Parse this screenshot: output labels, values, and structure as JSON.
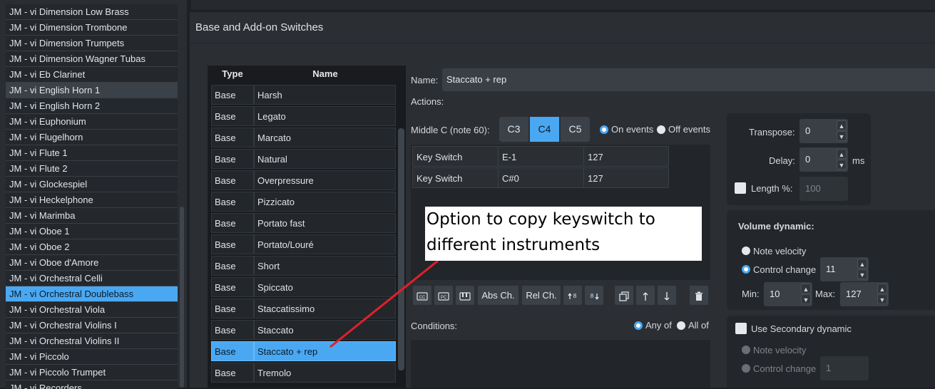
{
  "instrument_list": {
    "items": [
      {
        "label": "JM - vi Dimension Low Brass",
        "state": "normal"
      },
      {
        "label": "JM - vi Dimension Trombone",
        "state": "normal"
      },
      {
        "label": "JM - vi Dimension Trumpets",
        "state": "normal"
      },
      {
        "label": "JM - vi Dimension Wagner Tubas",
        "state": "normal"
      },
      {
        "label": "JM - vi Eb Clarinet",
        "state": "normal"
      },
      {
        "label": "JM - vi English Horn 1",
        "state": "hover"
      },
      {
        "label": "JM - vi English Horn 2",
        "state": "normal"
      },
      {
        "label": "JM - vi Euphonium",
        "state": "normal"
      },
      {
        "label": "JM - vi Flugelhorn",
        "state": "normal"
      },
      {
        "label": "JM - vi Flute 1",
        "state": "normal"
      },
      {
        "label": "JM - vi Flute 2",
        "state": "normal"
      },
      {
        "label": "JM - vi Glockespiel",
        "state": "normal"
      },
      {
        "label": "JM - vi Heckelphone",
        "state": "normal"
      },
      {
        "label": "JM - vi Marimba",
        "state": "normal"
      },
      {
        "label": "JM - vi Oboe 1",
        "state": "normal"
      },
      {
        "label": "JM - vi Oboe 2",
        "state": "normal"
      },
      {
        "label": "JM - vi Oboe d'Amore",
        "state": "normal"
      },
      {
        "label": "JM - vi Orchestral Celli",
        "state": "normal"
      },
      {
        "label": "JM - vi Orchestral Doublebass",
        "state": "selected"
      },
      {
        "label": "JM - vi Orchestral Viola",
        "state": "normal"
      },
      {
        "label": "JM - vi Orchestral Violins I",
        "state": "normal"
      },
      {
        "label": "JM - vi Orchestral Violins II",
        "state": "normal"
      },
      {
        "label": "JM - vi Piccolo",
        "state": "normal"
      },
      {
        "label": "JM - vi Piccolo Trumpet",
        "state": "normal"
      },
      {
        "label": "JM - vi Recorders",
        "state": "normal"
      }
    ]
  },
  "section": {
    "title": "Base and Add-on Switches"
  },
  "articulations": {
    "headers": {
      "type": "Type",
      "name": "Name"
    },
    "rows": [
      {
        "type": "Base",
        "name": "Harsh",
        "selected": false
      },
      {
        "type": "Base",
        "name": "Legato",
        "selected": false
      },
      {
        "type": "Base",
        "name": "Marcato",
        "selected": false
      },
      {
        "type": "Base",
        "name": "Natural",
        "selected": false
      },
      {
        "type": "Base",
        "name": "Overpressure",
        "selected": false
      },
      {
        "type": "Base",
        "name": "Pizzicato",
        "selected": false
      },
      {
        "type": "Base",
        "name": "Portato fast",
        "selected": false
      },
      {
        "type": "Base",
        "name": "Portato/Louré",
        "selected": false
      },
      {
        "type": "Base",
        "name": "Short",
        "selected": false
      },
      {
        "type": "Base",
        "name": "Spiccato",
        "selected": false
      },
      {
        "type": "Base",
        "name": "Staccatissimo",
        "selected": false
      },
      {
        "type": "Base",
        "name": "Staccato",
        "selected": false
      },
      {
        "type": "Base",
        "name": "Staccato + rep",
        "selected": true
      },
      {
        "type": "Base",
        "name": "Tremolo",
        "selected": false
      }
    ]
  },
  "editor": {
    "name_label": "Name:",
    "name_value": "Staccato + rep",
    "actions_label": "Actions:",
    "middle_c_label": "Middle C (note 60):",
    "octaves": [
      {
        "label": "C3",
        "active": false
      },
      {
        "label": "C4",
        "active": true
      },
      {
        "label": "C5",
        "active": false
      }
    ],
    "on_events_label": "On events",
    "off_events_label": "Off events",
    "events": [
      {
        "kind": "Key Switch",
        "note": "E-1",
        "value": "127"
      },
      {
        "kind": "Key Switch",
        "note": "C#0",
        "value": "127"
      }
    ],
    "toolbar": {
      "abs_ch": "Abs Ch.",
      "rel_ch": "Rel Ch."
    },
    "conditions_label": "Conditions:",
    "any_of_label": "Any of",
    "all_of_label": "All of"
  },
  "timing": {
    "transpose_label": "Transpose:",
    "transpose_value": "0",
    "delay_label": "Delay:",
    "delay_value": "0",
    "delay_unit": "ms",
    "length_label": "Length %:",
    "length_value": "100"
  },
  "volume": {
    "title": "Volume dynamic:",
    "note_velocity_label": "Note velocity",
    "control_change_label": "Control change",
    "cc_value": "11",
    "min_label": "Min:",
    "min_value": "10",
    "max_label": "Max:",
    "max_value": "127"
  },
  "secondary": {
    "title": "Use Secondary dynamic",
    "note_velocity_label": "Note velocity",
    "control_change_label": "Control change",
    "cc_value": "1"
  },
  "annotation": {
    "line1": "Option to copy keyswitch to",
    "line2": "different instruments",
    "arrow_color": "#e0202a"
  },
  "colors": {
    "accent": "#4aa8f2",
    "background": "#2b2f34"
  }
}
